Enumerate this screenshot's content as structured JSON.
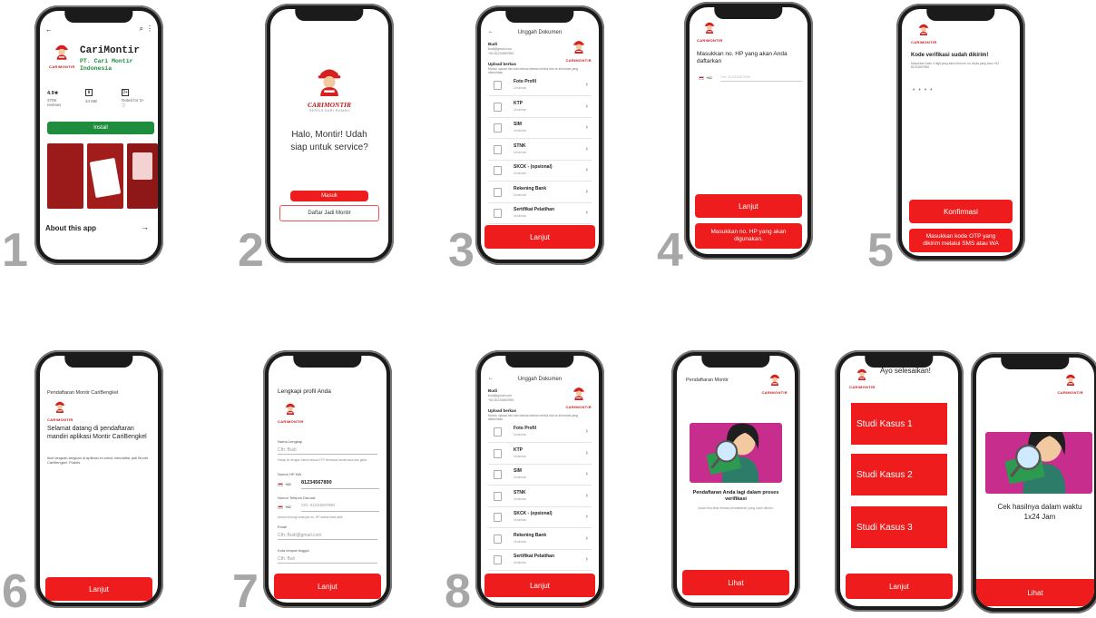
{
  "step_numbers": [
    "1",
    "2",
    "3",
    "4",
    "5",
    "6",
    "7",
    "8"
  ],
  "colors": {
    "brand_red": "#ee1c1c",
    "install_green": "#1e8e3e",
    "illus_magenta": "#c62d8c"
  },
  "screen1": {
    "app_name": "CariMontir",
    "publisher": "PT. Cari Montir Indonesia",
    "brand_small": "CARIMONTIR",
    "rating": "4.9★",
    "reviews": "370K reviews",
    "size": "34 MB",
    "rated": "Rated for 3+ ⓘ",
    "install": "Install",
    "about": "About this app",
    "arrow": "→"
  },
  "screen2": {
    "brand": "CARIMONTIR",
    "tagline": "SERVIS DARI RUMAH",
    "greeting": "Halo, Montir! Udah siap untuk service?",
    "login": "Masuk",
    "register": "Daftar Jadi Montir"
  },
  "documents": {
    "title": "Unggah Dokumen",
    "user_name": "Budi",
    "user_email": "budi@gmail.com",
    "user_phone": "+62 81234567890",
    "brand": "CARIMONTIR",
    "section": "Upload berkas",
    "section_desc": "Mohon upload foto dari berkas-berkas berikut dan isi informasi yang dibutuhkan.",
    "items": [
      {
        "label": "Foto Profil",
        "sub": "Unduhan"
      },
      {
        "label": "KTP",
        "sub": "Unduhan"
      },
      {
        "label": "SIM",
        "sub": "Unduhan"
      },
      {
        "label": "STNK",
        "sub": "Unduhan"
      },
      {
        "label": "SKCK - (opsional)",
        "sub": "Unduhan"
      },
      {
        "label": "Rekening Bank",
        "sub": "Unduhan"
      },
      {
        "label": "Sertifikat Pelatihan",
        "sub": "Unduhan"
      }
    ],
    "next": "Lanjut"
  },
  "screen4": {
    "brand": "CARIMONTIR",
    "title": "Masukkan no. HP yang akan Anda daftarkan",
    "country_code": "+62",
    "placeholder": "Cth: 81234567890",
    "next": "Lanjut",
    "hint": "Masukkan no. HP yang akan digunakan."
  },
  "screen5": {
    "brand": "CARIMONTIR",
    "title": "Kode verifikasi sudah dikirim!",
    "desc": "Masukkan kode 4 digit yang kami kirim ke no. Anda yang baru +62 81234567890.",
    "otp": "• • • •",
    "confirm": "Konfirmasi",
    "hint": "Masukkan kode OTP yang dikirim melalui SMS atau WA"
  },
  "screen6": {
    "header": "Pendaftaran Montir CariBengkel",
    "brand": "CARIMONTIR",
    "welcome": "Selamat datang di pendaftaran mandiri aplikasi Montir CariBengkel",
    "desc": "Ikuti langkah-langkah di aplikasi ini untuk mendaftar jadi Montir CariBengkel. Praktis.",
    "next": "Lanjut"
  },
  "screen7": {
    "title": "Lengkapi profil Anda",
    "brand": "CARIMONTIR",
    "fields": [
      {
        "label": "Nama Lengkap",
        "value": "Cth: Budi"
      },
      {
        "label": "Nomor HP WA",
        "value": "81234567890"
      },
      {
        "label": "Nomor Telepon Darurat",
        "value": "Cth: 81234567890"
      },
      {
        "label": "Email",
        "value": "Cth: Budi@gmail.com"
      },
      {
        "label": "Kota tempat tinggal",
        "value": "Cth: Bali"
      }
    ],
    "name_hint": "Harap isi dengan nama sesuai KTP termasuk tanda baca dan gelar.",
    "emergency_hint": "Untuk hubungi anda jika no. HP utama tidak aktif.",
    "country_code": "+62",
    "next": "Lanjut"
  },
  "screen9": {
    "header": "Pendaftaran Montir",
    "brand": "CARIMONTIR",
    "status": "Pendaftaran Anda lagi dalam proses verifikasi",
    "desc": "Anda bisa lihat berkas pendaftaran yang udah dikirim.",
    "view": "Lihat"
  },
  "screen10": {
    "title": "Ayo selesaikan!",
    "brand": "CARIMONTIR",
    "cases": [
      "Studi Kasus 1",
      "Studi Kasus 2",
      "Studi Kasus 3"
    ],
    "next": "Lanjut"
  },
  "screen11": {
    "brand": "CARIMONTIR",
    "message": "Cek hasilnya dalam waktu 1x24 Jam",
    "view": "Lihat"
  }
}
